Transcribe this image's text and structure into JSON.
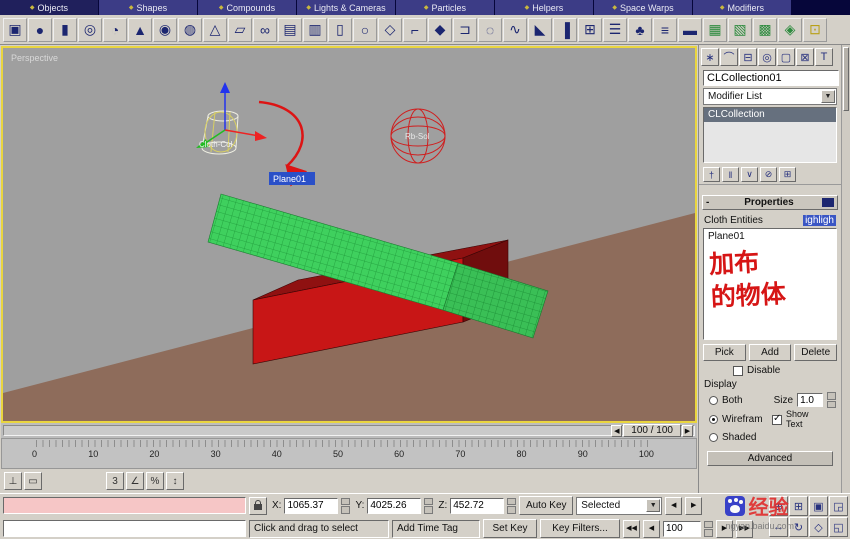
{
  "tab_bar": {
    "bullet_glyph": "◆",
    "tabs": [
      {
        "label": "Objects"
      },
      {
        "label": "Shapes"
      },
      {
        "label": "Compounds"
      },
      {
        "label": "Lights & Cameras"
      },
      {
        "label": "Particles"
      },
      {
        "label": "Helpers"
      },
      {
        "label": "Space Warps"
      },
      {
        "label": "Modifiers"
      }
    ]
  },
  "icons": {
    "dropdown_arrow": "▼"
  },
  "toolbar": {
    "icons": [
      {
        "name": "box-icon",
        "glyph": "▣"
      },
      {
        "name": "sphere-icon",
        "glyph": "●"
      },
      {
        "name": "cylinder-icon",
        "glyph": "▮"
      },
      {
        "name": "torus-icon",
        "glyph": "◎"
      },
      {
        "name": "teapot-icon",
        "glyph": "◔"
      },
      {
        "name": "cone-icon",
        "glyph": "▲"
      },
      {
        "name": "geosphere-icon",
        "glyph": "◉"
      },
      {
        "name": "tube-icon",
        "glyph": "◍"
      },
      {
        "name": "pyramid-icon",
        "glyph": "△"
      },
      {
        "name": "plane-icon",
        "glyph": "▱"
      },
      {
        "name": "torus-knot-icon",
        "glyph": "∞"
      },
      {
        "name": "chamfer-box-icon",
        "glyph": "▤"
      },
      {
        "name": "chamfer-cylinder-icon",
        "glyph": "▥"
      },
      {
        "name": "oil-tank-icon",
        "glyph": "▯"
      },
      {
        "name": "capsule-icon",
        "glyph": "○"
      },
      {
        "name": "spindle-icon",
        "glyph": "◇"
      },
      {
        "name": "l-ext-icon",
        "glyph": "⌐"
      },
      {
        "name": "gengon-icon",
        "glyph": "◆"
      },
      {
        "name": "c-ext-icon",
        "glyph": "⊐"
      },
      {
        "name": "ring-wave-icon",
        "glyph": "◌"
      },
      {
        "name": "hose-icon",
        "glyph": "∿"
      },
      {
        "name": "prism-icon",
        "glyph": "◣"
      },
      {
        "name": "door-icon",
        "glyph": "▐"
      },
      {
        "name": "window-icon",
        "glyph": "⊞"
      },
      {
        "name": "stairs-icon",
        "glyph": "☰"
      },
      {
        "name": "foliage-icon",
        "glyph": "♣"
      },
      {
        "name": "railing-icon",
        "glyph": "≡"
      },
      {
        "name": "wall-icon",
        "glyph": "▬"
      },
      {
        "name": "quad-patch-icon",
        "glyph": "▦",
        "color": "#2e8b3e"
      },
      {
        "name": "tri-patch-icon",
        "glyph": "▧",
        "color": "#2e8b3e"
      },
      {
        "name": "nurbs-surface-icon",
        "glyph": "▩",
        "color": "#2e8b3e"
      },
      {
        "name": "cv-surface-icon",
        "glyph": "◈",
        "color": "#2e8b3e"
      },
      {
        "name": "viewport-window-icon",
        "glyph": "⊡",
        "color": "#b8a018"
      }
    ]
  },
  "viewport": {
    "view_label": "Perspective",
    "labels": {
      "cloth_object": "Cloth-Col",
      "sphere_object": "Rb-Sol",
      "plane_object": "Plane01"
    },
    "colors": {
      "sky": "#9f9f9f",
      "ground": "#8e6c5b",
      "box_top": "#8f1111",
      "box_front": "#c81616",
      "box_side": "#700d0d",
      "cloth": "#3fd05e",
      "cloth_grid": "#1e9a3a",
      "border": "#e9d53f",
      "annotation": "#dd1414"
    }
  },
  "time_slider": {
    "value": "100 / 100",
    "left_glyph": "◀",
    "right_glyph": "▶"
  },
  "track_bar": {
    "ticks": [
      "0",
      "10",
      "20",
      "30",
      "40",
      "50",
      "60",
      "70",
      "80",
      "90",
      "100"
    ]
  },
  "snap_bar": {
    "left_icons": [
      {
        "name": "axis-constraint-icon",
        "glyph": "⊥"
      },
      {
        "name": "mini-curve-editor-icon",
        "glyph": "▭"
      }
    ],
    "snap_icons": [
      {
        "name": "snap-toggle-3d-icon",
        "glyph": "3"
      },
      {
        "name": "angle-snap-icon",
        "glyph": "∠"
      },
      {
        "name": "percent-snap-icon",
        "glyph": "%"
      },
      {
        "name": "spinner-snap-icon",
        "glyph": "↕"
      }
    ]
  },
  "command_panel": {
    "tabs_icons": [
      {
        "name": "create-tab-icon",
        "glyph": "∗"
      },
      {
        "name": "modify-tab-icon",
        "glyph": "⌒"
      },
      {
        "name": "hierarchy-tab-icon",
        "glyph": "⊟"
      },
      {
        "name": "motion-tab-icon",
        "glyph": "◎"
      },
      {
        "name": "display-tab-icon",
        "glyph": "▢"
      },
      {
        "name": "utilities-tab-icon",
        "glyph": "⊠"
      },
      {
        "name": "text-tool-icon",
        "glyph": "T"
      }
    ],
    "object_name": "CLCollection01",
    "modifier_list_label": "Modifier List",
    "modifier_stack": [
      "CLCollection"
    ],
    "stack_tools": [
      {
        "name": "pin-stack-icon",
        "glyph": "†"
      },
      {
        "name": "show-end-result-icon",
        "glyph": "‖"
      },
      {
        "name": "make-unique-icon",
        "glyph": "∨"
      },
      {
        "name": "remove-modifier-icon",
        "glyph": "⊘"
      },
      {
        "name": "configure-modifier-sets-icon",
        "glyph": "⊞"
      }
    ],
    "rollout": {
      "collapse_glyph": "-",
      "title": "Properties",
      "entities_label": "Cloth Entities",
      "highlight_text": "ighligh",
      "objects": [
        "Plane01"
      ],
      "annotation_line1": "加布",
      "annotation_line2": "的物体",
      "pick": "Pick",
      "add": "Add",
      "delete": "Delete",
      "disable": "Disable",
      "display": "Display",
      "radio_both": "Both",
      "radio_wireframe": "Wirefram",
      "radio_shaded": "Shaded",
      "size_label": "Size",
      "size_value": "1.0",
      "show_text_1": "Show",
      "show_text_2": "Text",
      "advanced": "Advanced"
    }
  },
  "status_bar": {
    "x_label": "X:",
    "x_value": "1065.37",
    "y_label": "Y:",
    "y_value": "4025.26",
    "z_label": "Z:",
    "z_value": "452.72",
    "auto_key": "Auto Key",
    "set_key": "Set Key",
    "selection_set": "Selected",
    "key_filters": "Key Filters...",
    "prompt": "Click and drag to select",
    "time_tag": "Add Time Tag",
    "frame": "100",
    "prev_key": "◀",
    "next_key": "▶",
    "transport": {
      "go_start": "◀◀",
      "prev": "◀",
      "next": "▶",
      "go_end": "▶▶"
    }
  },
  "nav_icons": [
    {
      "name": "zoom-icon",
      "glyph": "⊕"
    },
    {
      "name": "zoom-all-icon",
      "glyph": "⊞"
    },
    {
      "name": "zoom-extents-icon",
      "glyph": "▣"
    },
    {
      "name": "zoom-region-icon",
      "glyph": "◲"
    },
    {
      "name": "pan-icon",
      "glyph": "↔"
    },
    {
      "name": "arc-rotate-icon",
      "glyph": "↻"
    },
    {
      "name": "field-of-view-icon",
      "glyph": "◇"
    },
    {
      "name": "maximize-viewport-icon",
      "glyph": "◱"
    }
  ],
  "watermark": {
    "brand": "经验",
    "url": "ngyan.baidu.com"
  }
}
